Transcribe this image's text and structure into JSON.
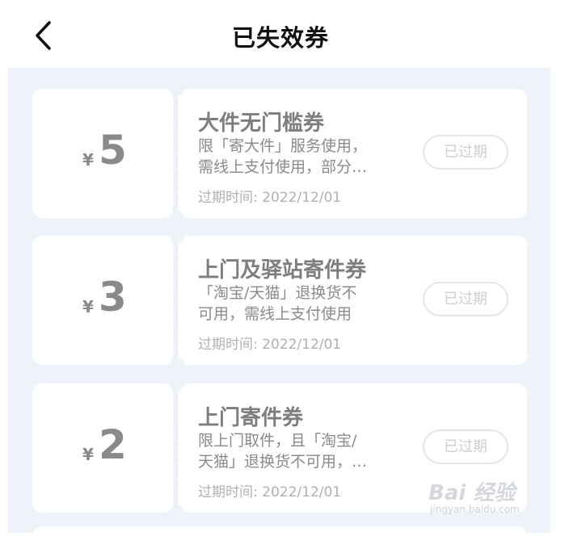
{
  "header": {
    "title": "已失效券",
    "back_icon": "chevron-left-icon"
  },
  "coupons": [
    {
      "currency": "¥",
      "amount": "5",
      "name": "大件无门槛券",
      "desc_line1": "限「寄大件」服务使用，",
      "desc_line2": "需线上支付使用，部分…",
      "expire": "过期时间: 2022/12/01",
      "status": "已过期"
    },
    {
      "currency": "¥",
      "amount": "3",
      "name": "上门及驿站寄件券",
      "desc_line1": "「淘宝/天猫」退换货不",
      "desc_line2": "可用，需线上支付使用",
      "expire": "过期时间: 2022/12/01",
      "status": "已过期"
    },
    {
      "currency": "¥",
      "amount": "2",
      "name": "上门寄件券",
      "desc_line1": "限上门取件，且「淘宝/",
      "desc_line2": "天猫」退换货不可用，…",
      "expire": "过期时间: 2022/12/01",
      "status": "已过期"
    }
  ],
  "watermark": {
    "logo_text": "Bai 经验",
    "url": "jingyan.baidu.com"
  },
  "colors": {
    "panel_bg": "#eef3fa",
    "card_bg": "#ffffff",
    "amount": "#8a8a8a",
    "title": "#111111",
    "muted": "#b0b0b0"
  }
}
